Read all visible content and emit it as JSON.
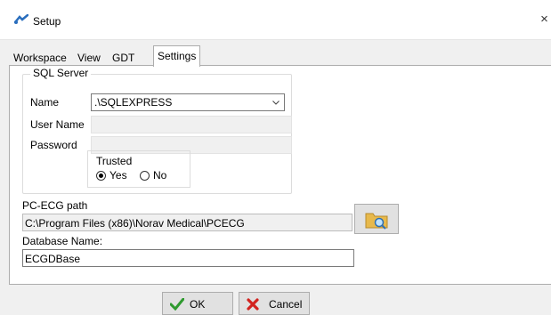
{
  "window": {
    "title": "Setup",
    "close_glyph": "×",
    "icon": "setup-app-icon"
  },
  "tabs": [
    {
      "label": "Workspace",
      "active": false
    },
    {
      "label": "View",
      "active": false
    },
    {
      "label": "GDT",
      "active": false
    },
    {
      "label": "Settings",
      "active": true
    }
  ],
  "sql_server": {
    "group_title": "SQL Server",
    "name_label": "Name",
    "name_value": ".\\SQLEXPRESS",
    "user_name_label": "User Name",
    "user_name_value": "",
    "password_label": "Password",
    "password_value": "",
    "trusted": {
      "title": "Trusted",
      "options": [
        {
          "label": "Yes",
          "checked": true
        },
        {
          "label": "No",
          "checked": false
        }
      ]
    }
  },
  "pc_ecg": {
    "label": "PC-ECG path",
    "path_value": "C:\\Program Files (x86)\\Norav Medical\\PCECG",
    "browse_icon": "folder-search-icon"
  },
  "database": {
    "label": "Database Name:",
    "value": "ECGDBase"
  },
  "buttons": {
    "ok_label": "OK",
    "cancel_label": "Cancel"
  },
  "colors": {
    "ok_check": "#2f9a2f",
    "cancel_x": "#d2231f",
    "folder": "#e7b94c"
  }
}
